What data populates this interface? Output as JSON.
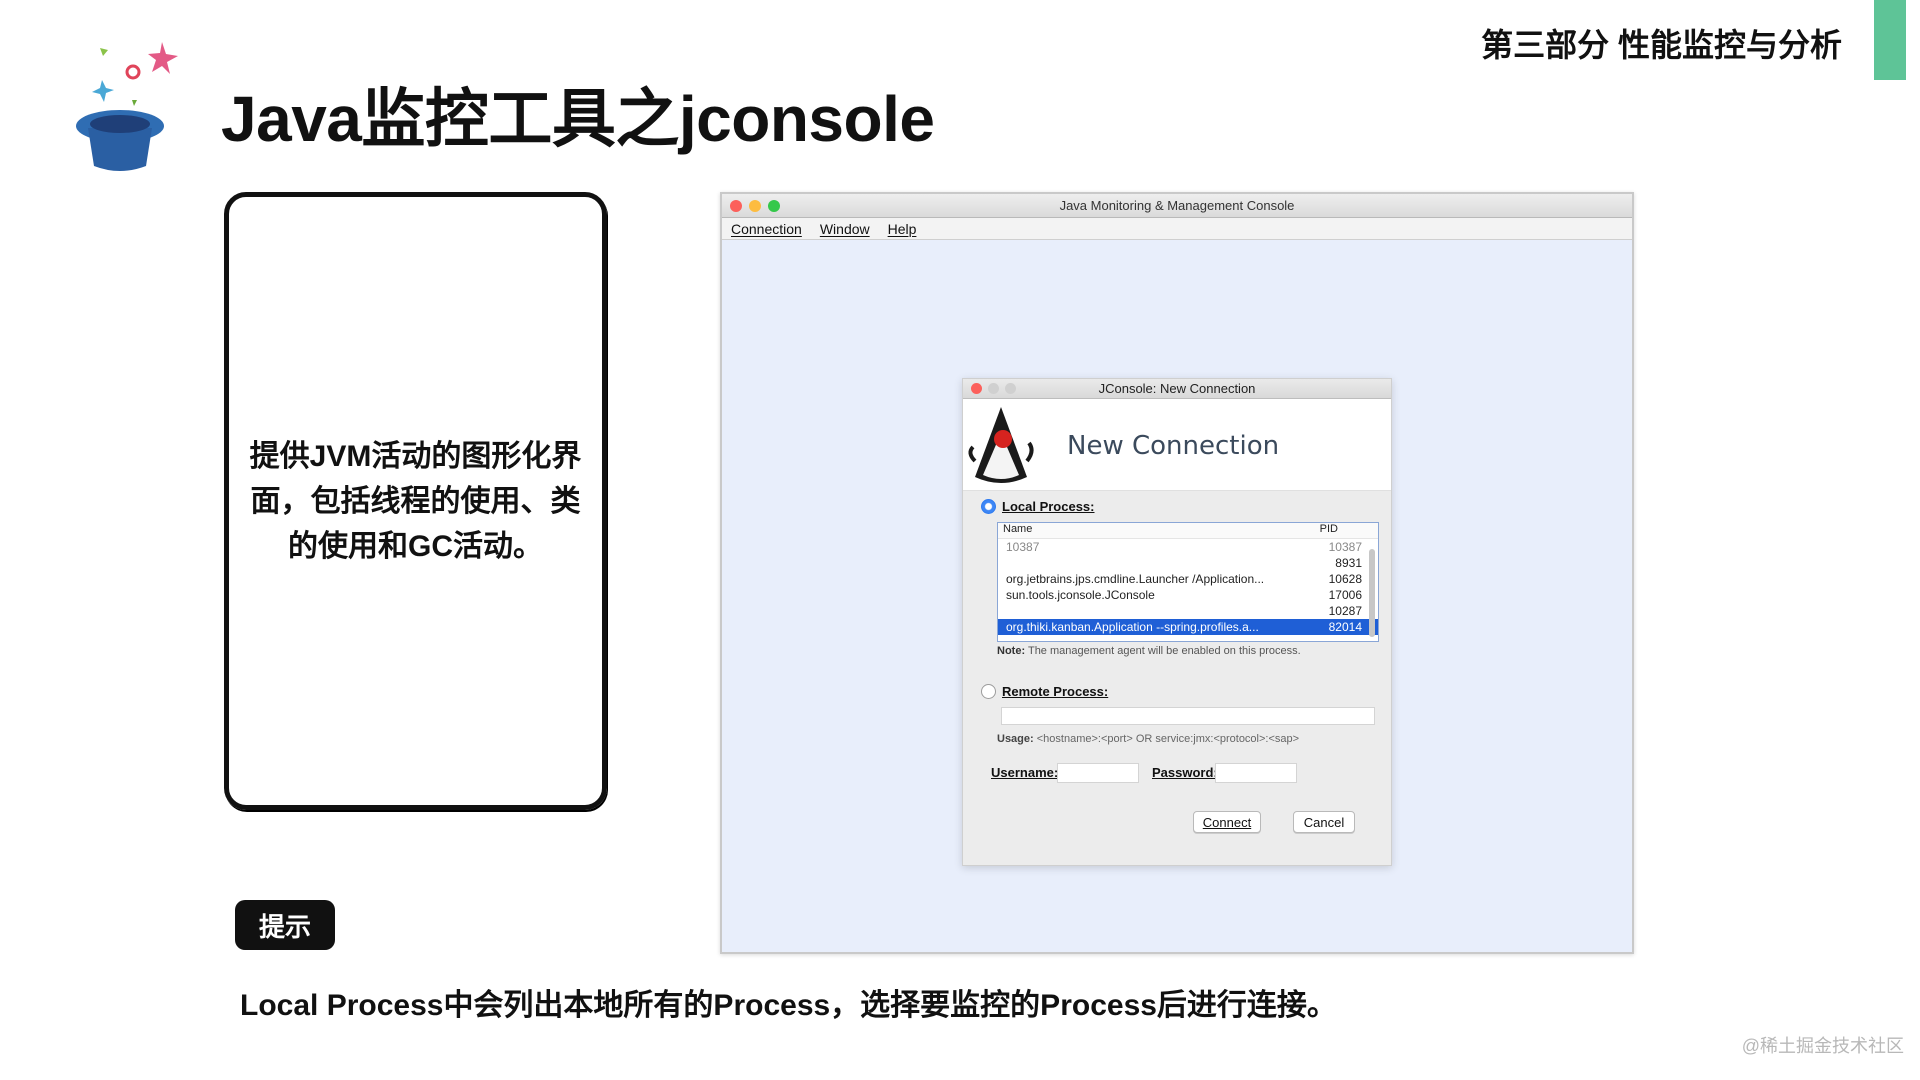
{
  "header": {
    "section_label": "第三部分 性能监控与分析",
    "title": "Java监控工具之jconsole",
    "accent_color": "#5ec497"
  },
  "card": {
    "text": "提供JVM活动的图形化界面，包括线程的使用、类的使用和GC活动。"
  },
  "tip": {
    "badge": "提示",
    "text": "Local Process中会列出本地所有的Process，选择要监控的Process后进行连接。"
  },
  "watermark": "@稀土掘金技术社区",
  "jmc": {
    "window_title": "Java Monitoring & Management Console",
    "menu": [
      "Connection",
      "Window",
      "Help"
    ],
    "dialog": {
      "title": "JConsole: New Connection",
      "heading": "New Connection",
      "local_process_label": "Local Process:",
      "local_selected": true,
      "table_headers": {
        "name": "Name",
        "pid": "PID"
      },
      "processes": [
        {
          "name": "10387",
          "pid": "10387",
          "dim": true
        },
        {
          "name": "",
          "pid": "8931"
        },
        {
          "name": "org.jetbrains.jps.cmdline.Launcher /Application...",
          "pid": "10628"
        },
        {
          "name": "sun.tools.jconsole.JConsole",
          "pid": "17006"
        },
        {
          "name": "",
          "pid": "10287"
        },
        {
          "name": "org.thiki.kanban.Application --spring.profiles.a...",
          "pid": "82014",
          "selected": true
        }
      ],
      "note_label": "Note:",
      "note_text": "The management agent will be enabled on this process.",
      "remote_process_label": "Remote Process:",
      "remote_value": "",
      "usage_label": "Usage:",
      "usage_text": "<hostname>:<port> OR service:jmx:<protocol>:<sap>",
      "username_label": "Username:",
      "username_value": "",
      "password_label": "Password:",
      "password_value": "",
      "connect_label": "Connect",
      "cancel_label": "Cancel"
    }
  }
}
